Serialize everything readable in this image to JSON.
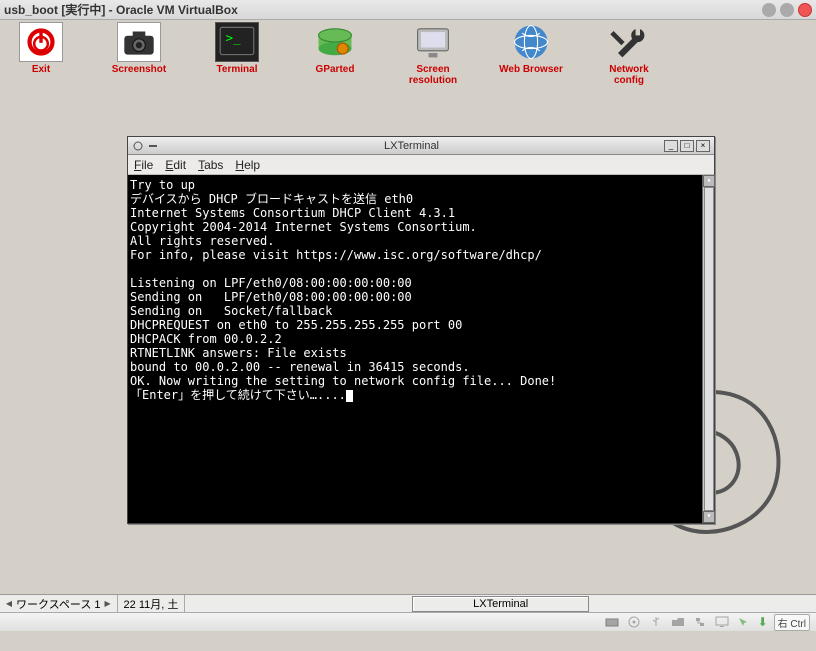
{
  "vbox": {
    "title": "usb_boot [実行中] - Oracle VM VirtualBox",
    "hostkey": "右 Ctrl"
  },
  "desktop": {
    "icons": [
      {
        "id": "exit",
        "label": "Exit"
      },
      {
        "id": "screenshot",
        "label": "Screenshot"
      },
      {
        "id": "terminal",
        "label": "Terminal"
      },
      {
        "id": "gparted",
        "label": "GParted"
      },
      {
        "id": "screenres",
        "label": "Screen resolution"
      },
      {
        "id": "browser",
        "label": "Web Browser"
      },
      {
        "id": "netconf",
        "label": "Network config"
      }
    ]
  },
  "lxterminal": {
    "title": "LXTerminal",
    "menus": {
      "file": "File",
      "edit": "Edit",
      "tabs": "Tabs",
      "help": "Help"
    },
    "lines": [
      "Try to up",
      "デバイスから DHCP ブロードキャストを送信 eth0",
      "Internet Systems Consortium DHCP Client 4.3.1",
      "Copyright 2004-2014 Internet Systems Consortium.",
      "All rights reserved.",
      "For info, please visit https://www.isc.org/software/dhcp/",
      "",
      "Listening on LPF/eth0/08:00:00:00:00:00",
      "Sending on   LPF/eth0/08:00:00:00:00:00",
      "Sending on   Socket/fallback",
      "DHCPREQUEST on eth0 to 255.255.255.255 port 00",
      "DHCPACK from 00.0.2.2",
      "RTNETLINK answers: File exists",
      "bound to 00.0.2.00 -- renewal in 36415 seconds.",
      "OK. Now writing the setting to network config file... Done!",
      "「Enter」を押して続けて下さい…...."
    ]
  },
  "taskbar": {
    "workspace": "ワークスペース 1",
    "date": "22 11月, 土",
    "task_label": "LXTerminal"
  },
  "status_icons": [
    "disk-icon",
    "optical-icon",
    "usb-icon",
    "folder-icon",
    "network-icon",
    "display-icon",
    "mouse-icon",
    "record-icon"
  ]
}
